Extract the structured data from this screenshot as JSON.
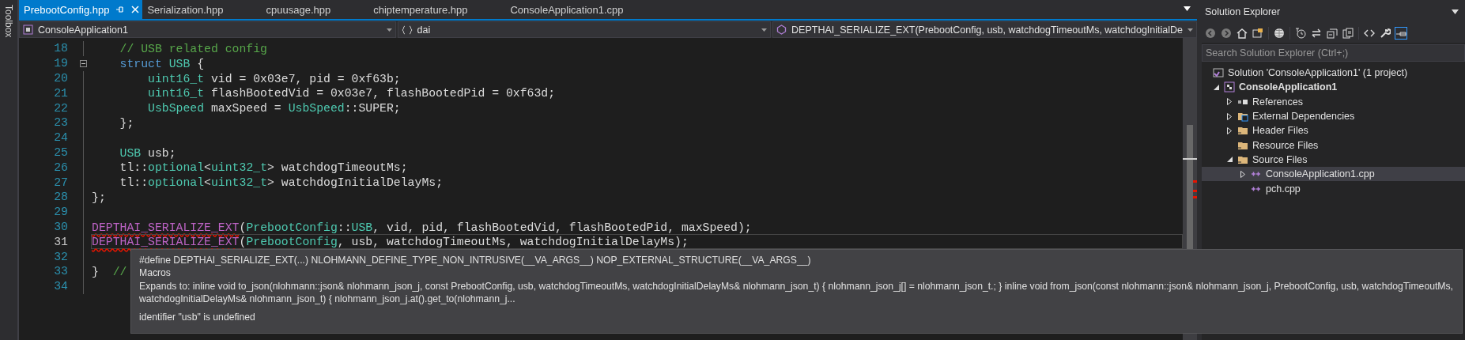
{
  "toolbox": {
    "label": "Toolbox"
  },
  "tabs": [
    {
      "label": "PrebootConfig.hpp",
      "selected": true
    },
    {
      "label": "Serialization.hpp",
      "selected": false
    },
    {
      "label": "cpuusage.hpp",
      "selected": false
    },
    {
      "label": "chiptemperature.hpp",
      "selected": false
    },
    {
      "label": "ConsoleApplication1.cpp",
      "selected": false
    }
  ],
  "navigation": {
    "project": "ConsoleApplication1",
    "scope": "dai",
    "member": "DEPTHAI_SERIALIZE_EXT(PrebootConfig, usb, watchdogTimeoutMs, watchdogInitialDe"
  },
  "editor": {
    "lines": [
      {
        "number": "18",
        "fold": false,
        "current": false,
        "tokens": [
          {
            "kind": "comment",
            "text": "    // USB related config"
          }
        ]
      },
      {
        "number": "19",
        "fold": true,
        "current": false,
        "tokens": [
          {
            "kind": "keyword",
            "text": "    struct"
          },
          {
            "kind": "type",
            "text": " USB"
          },
          {
            "kind": "plain",
            "text": " {"
          }
        ]
      },
      {
        "number": "20",
        "fold": false,
        "current": false,
        "tokens": [
          {
            "kind": "type",
            "text": "        uint16_t"
          },
          {
            "kind": "plain",
            "text": " vid = 0x03e7, pid = 0xf63b;"
          }
        ]
      },
      {
        "number": "21",
        "fold": false,
        "current": false,
        "tokens": [
          {
            "kind": "type",
            "text": "        uint16_t"
          },
          {
            "kind": "plain",
            "text": " flashBootedVid = 0x03e7, flashBootedPid = 0xf63d;"
          }
        ]
      },
      {
        "number": "22",
        "fold": false,
        "current": false,
        "tokens": [
          {
            "kind": "type",
            "text": "        UsbSpeed"
          },
          {
            "kind": "plain",
            "text": " maxSpeed = "
          },
          {
            "kind": "type",
            "text": "UsbSpeed"
          },
          {
            "kind": "plain",
            "text": "::SUPER;"
          }
        ]
      },
      {
        "number": "23",
        "fold": false,
        "current": false,
        "tokens": [
          {
            "kind": "plain",
            "text": "    };"
          }
        ]
      },
      {
        "number": "24",
        "fold": false,
        "current": false
      },
      {
        "number": "25",
        "fold": false,
        "current": false,
        "tokens": [
          {
            "kind": "type",
            "text": "    USB"
          },
          {
            "kind": "plain",
            "text": " usb;"
          }
        ]
      },
      {
        "number": "26",
        "fold": false,
        "current": false,
        "tokens": [
          {
            "kind": "plain",
            "text": "    tl::"
          },
          {
            "kind": "type",
            "text": "optional"
          },
          {
            "kind": "plain",
            "text": "<"
          },
          {
            "kind": "type",
            "text": "uint32_t"
          },
          {
            "kind": "plain",
            "text": "> watchdogTimeoutMs;"
          }
        ]
      },
      {
        "number": "27",
        "fold": false,
        "current": false,
        "tokens": [
          {
            "kind": "plain",
            "text": "    tl::"
          },
          {
            "kind": "type",
            "text": "optional"
          },
          {
            "kind": "plain",
            "text": "<"
          },
          {
            "kind": "type",
            "text": "uint32_t"
          },
          {
            "kind": "plain",
            "text": "> watchdogInitialDelayMs;"
          }
        ]
      },
      {
        "number": "28",
        "fold": false,
        "current": false,
        "tokens": [
          {
            "kind": "plain",
            "text": "};"
          }
        ]
      },
      {
        "number": "29",
        "fold": false,
        "current": false
      },
      {
        "number": "30",
        "fold": false,
        "current": false,
        "tokens": [
          {
            "kind": "macro",
            "text": "DEPTHAI_SERIALIZE_EXT",
            "error": true
          },
          {
            "kind": "plain",
            "text": "("
          },
          {
            "kind": "type",
            "text": "PrebootConfig"
          },
          {
            "kind": "plain",
            "text": "::"
          },
          {
            "kind": "type",
            "text": "USB"
          },
          {
            "kind": "plain",
            "text": ", vid, pid, flashBootedVid, flashBootedPid, maxSpeed);"
          }
        ]
      },
      {
        "number": "31",
        "fold": false,
        "current": true,
        "tokens": [
          {
            "kind": "macro",
            "text": "DEPTHAI_SERIALIZE_EXT",
            "error": true
          },
          {
            "kind": "plain",
            "text": "("
          },
          {
            "kind": "type",
            "text": "PrebootConfig"
          },
          {
            "kind": "plain",
            "text": ", usb, watchdogTimeoutMs, watchdogInitialDelayMs);"
          }
        ]
      },
      {
        "number": "32",
        "fold": false,
        "current": false
      },
      {
        "number": "33",
        "fold": false,
        "current": false,
        "tokens": [
          {
            "kind": "plain",
            "text": "}"
          },
          {
            "kind": "comment",
            "text": "  //"
          }
        ]
      },
      {
        "number": "34",
        "fold": false,
        "current": false
      }
    ]
  },
  "tooltip": {
    "signature": "#define DEPTHAI_SERIALIZE_EXT(...) NLOHMANN_DEFINE_TYPE_NON_INTRUSIVE(__VA_ARGS__) NOP_EXTERNAL_STRUCTURE(__VA_ARGS__)",
    "category": "Macros",
    "expansion": "Expands to: inline void to_json(nlohmann::json& nlohmann_json_j, const PrebootConfig, usb, watchdogTimeoutMs, watchdogInitialDelayMs& nlohmann_json_t) { nlohmann_json_j[] = nlohmann_json_t.; } inline void from_json(const nlohmann::json& nlohmann_json_j, PrebootConfig, usb, watchdogTimeoutMs, watchdogInitialDelayMs& nlohmann_json_t) { nlohmann_json_j.at().get_to(nlohmann_j...",
    "error": "identifier \"usb\" is undefined"
  },
  "solution_explorer": {
    "title": "Solution Explorer",
    "search": {
      "placeholder": "Search Solution Explorer (Ctrl+;)"
    },
    "tree": [
      {
        "label": "Solution 'ConsoleApplication1' (1 project)",
        "kind": "solution",
        "selected": false,
        "children": [
          {
            "label": "ConsoleApplication1",
            "kind": "project",
            "selected": false,
            "expanded": true,
            "children": [
              {
                "label": "References",
                "kind": "references",
                "selected": false,
                "expanded": false
              },
              {
                "label": "External Dependencies",
                "kind": "external",
                "selected": false,
                "expanded": false
              },
              {
                "label": "Header Files",
                "kind": "filter",
                "selected": false,
                "expanded": false
              },
              {
                "label": "Resource Files",
                "kind": "filter",
                "selected": false
              },
              {
                "label": "Source Files",
                "kind": "filter",
                "selected": false,
                "expanded": true,
                "children": [
                  {
                    "label": "ConsoleApplication1.cpp",
                    "kind": "file",
                    "selected": true,
                    "expanded": false
                  },
                  {
                    "label": "pch.cpp",
                    "kind": "file",
                    "selected": false
                  }
                ]
              }
            ]
          }
        ]
      }
    ]
  }
}
